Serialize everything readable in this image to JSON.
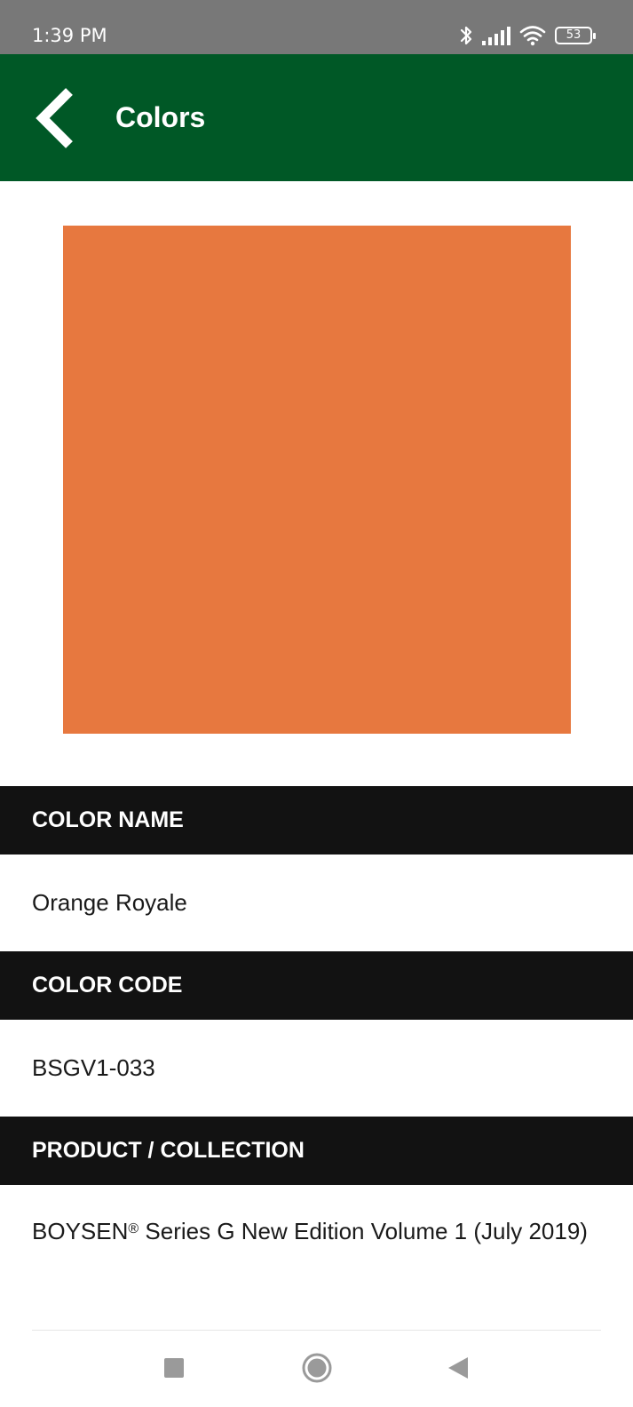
{
  "status_bar": {
    "time": "1:39 PM",
    "battery_level": "53",
    "icons": [
      "bluetooth-icon",
      "signal-icon",
      "wifi-icon",
      "battery-icon"
    ]
  },
  "app_bar": {
    "title": "Colors",
    "back_icon": "chevron-left-icon",
    "background_color": "#005826"
  },
  "swatch": {
    "color": "#E7783F"
  },
  "details": {
    "color_name_label": "COLOR NAME",
    "color_name_value": "Orange Royale",
    "color_code_label": "COLOR CODE",
    "color_code_value": "BSGV1-033",
    "product_label": "PRODUCT / COLLECTION",
    "product_brand": "BOYSEN",
    "product_registered_mark": "®",
    "product_rest": " Series G New Edition Volume 1 (July 2019)"
  },
  "nav_bar": {
    "icons": [
      "recent-apps-icon",
      "home-icon",
      "back-triangle-icon"
    ]
  }
}
